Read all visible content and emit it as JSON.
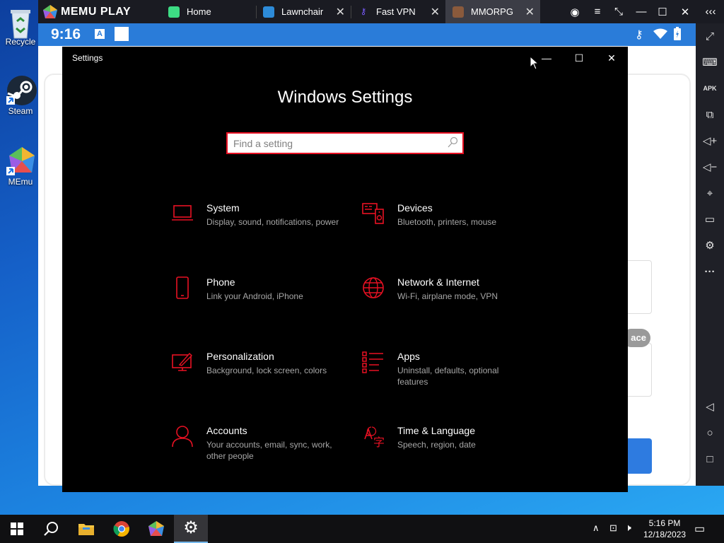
{
  "desktop": {
    "icons": [
      {
        "label": "Recycle"
      },
      {
        "label": "Steam"
      },
      {
        "label": "MEmu"
      }
    ]
  },
  "memu": {
    "logo_text": "MEMU PLAY",
    "tabs": [
      {
        "label": "Home",
        "icon_color": "#3ddc84"
      },
      {
        "label": "Lawnchair",
        "icon_color": "#2d8bd8"
      },
      {
        "label": "Fast VPN",
        "icon_color": "#7a5cff"
      },
      {
        "label": "MMORPG",
        "icon_color": "#8a5a3c"
      }
    ],
    "android_status": {
      "time": "9:16"
    },
    "app_background": {
      "pill_text": "ace"
    }
  },
  "settings_window": {
    "title": "Settings",
    "heading": "Windows Settings",
    "search_placeholder": "Find a setting",
    "accent_color": "#e81123",
    "categories": [
      {
        "name": "System",
        "desc": "Display, sound, notifications, power",
        "icon": "laptop-icon"
      },
      {
        "name": "Devices",
        "desc": "Bluetooth, printers, mouse",
        "icon": "devices-icon"
      },
      {
        "name": "Phone",
        "desc": "Link your Android, iPhone",
        "icon": "phone-icon"
      },
      {
        "name": "Network & Internet",
        "desc": "Wi-Fi, airplane mode, VPN",
        "icon": "globe-icon"
      },
      {
        "name": "Personalization",
        "desc": "Background, lock screen, colors",
        "icon": "paint-icon"
      },
      {
        "name": "Apps",
        "desc": "Uninstall, defaults, optional features",
        "icon": "apps-list-icon"
      },
      {
        "name": "Accounts",
        "desc": "Your accounts, email, sync, work, other people",
        "icon": "person-icon"
      },
      {
        "name": "Time & Language",
        "desc": "Speech, region, date",
        "icon": "time-language-icon"
      }
    ]
  },
  "taskbar": {
    "time": "5:16 PM",
    "date": "12/18/2023"
  }
}
